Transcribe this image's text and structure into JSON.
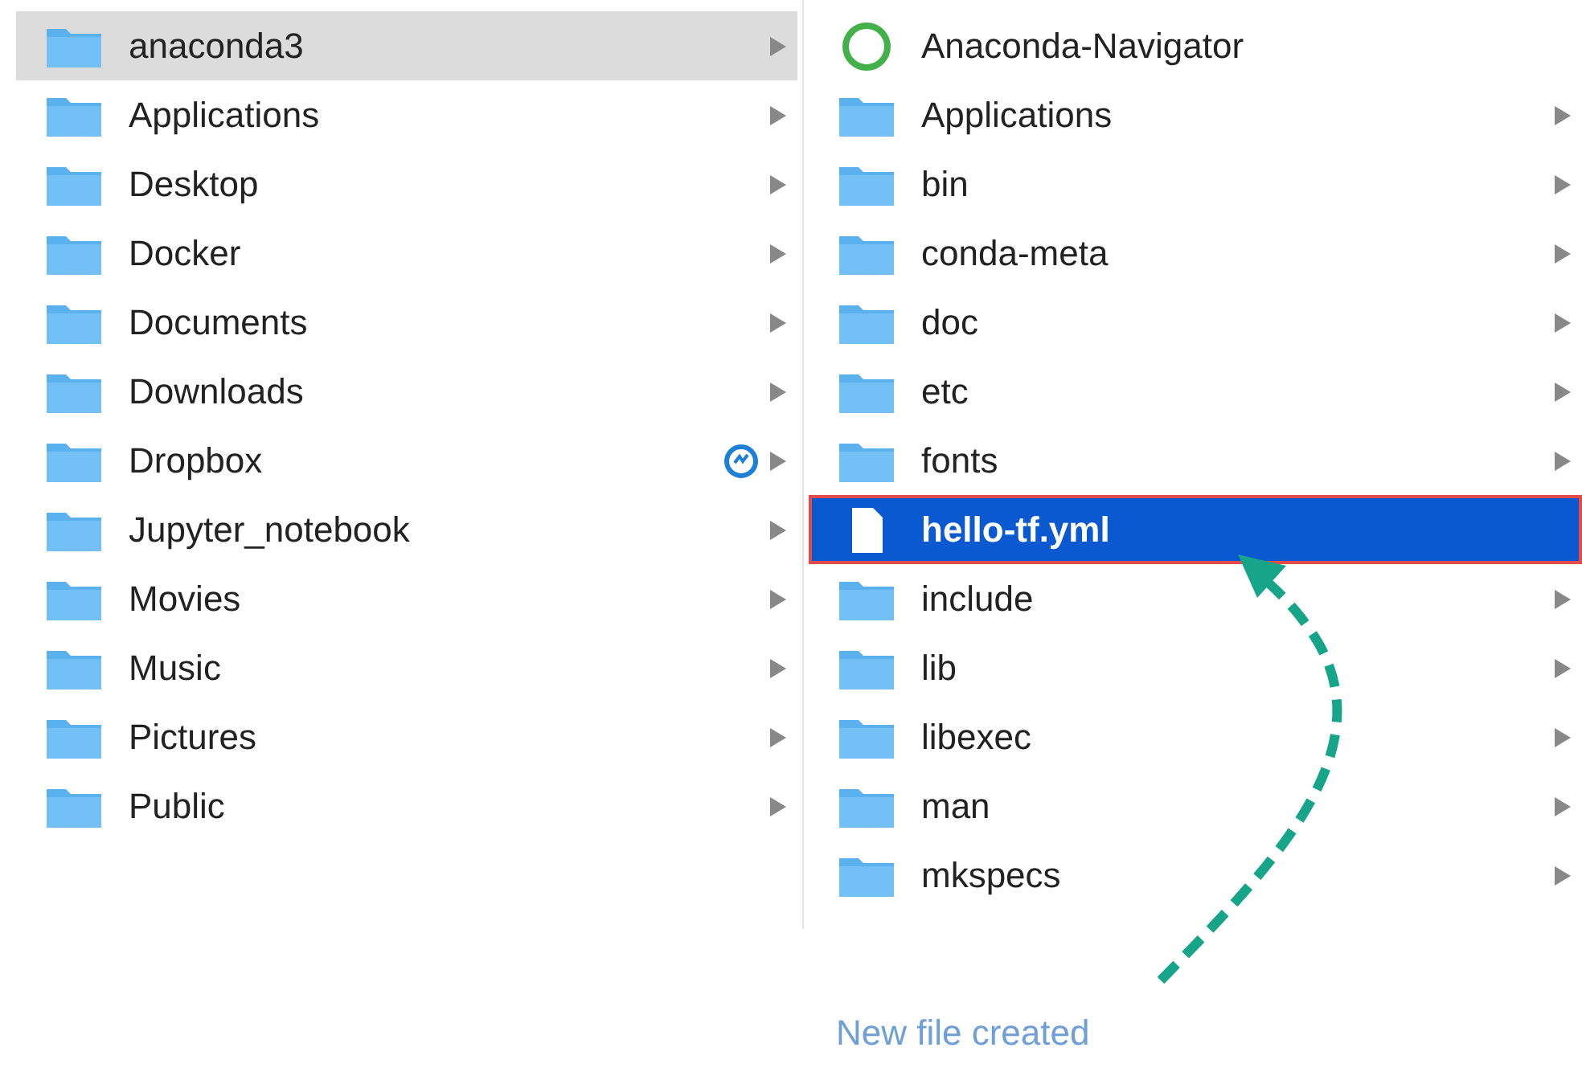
{
  "columns": [
    {
      "items": [
        {
          "name": "anaconda3",
          "kind": "folder",
          "selected": true,
          "has_children": true
        },
        {
          "name": "Applications",
          "kind": "folder",
          "selected": false,
          "has_children": true
        },
        {
          "name": "Desktop",
          "kind": "folder",
          "selected": false,
          "has_children": true
        },
        {
          "name": "Docker",
          "kind": "folder",
          "selected": false,
          "has_children": true
        },
        {
          "name": "Documents",
          "kind": "folder",
          "selected": false,
          "has_children": true
        },
        {
          "name": "Downloads",
          "kind": "folder",
          "selected": false,
          "has_children": true
        },
        {
          "name": "Dropbox",
          "kind": "folder",
          "selected": false,
          "has_children": true,
          "synced": true
        },
        {
          "name": "Jupyter_notebook",
          "kind": "folder",
          "selected": false,
          "has_children": true
        },
        {
          "name": "Movies",
          "kind": "folder",
          "selected": false,
          "has_children": true
        },
        {
          "name": "Music",
          "kind": "folder",
          "selected": false,
          "has_children": true
        },
        {
          "name": "Pictures",
          "kind": "folder",
          "selected": false,
          "has_children": true
        },
        {
          "name": "Public",
          "kind": "folder",
          "selected": false,
          "has_children": true
        }
      ]
    },
    {
      "items": [
        {
          "name": "Anaconda-Navigator",
          "kind": "app",
          "selected": false,
          "has_children": false
        },
        {
          "name": "Applications",
          "kind": "folder",
          "selected": false,
          "has_children": true
        },
        {
          "name": "bin",
          "kind": "folder",
          "selected": false,
          "has_children": true
        },
        {
          "name": "conda-meta",
          "kind": "folder",
          "selected": false,
          "has_children": true
        },
        {
          "name": "doc",
          "kind": "folder",
          "selected": false,
          "has_children": true
        },
        {
          "name": "etc",
          "kind": "folder",
          "selected": false,
          "has_children": true
        },
        {
          "name": "fonts",
          "kind": "folder",
          "selected": false,
          "has_children": true
        },
        {
          "name": "hello-tf.yml",
          "kind": "file",
          "selected": true,
          "has_children": false,
          "outlined": true
        },
        {
          "name": "include",
          "kind": "folder",
          "selected": false,
          "has_children": true
        },
        {
          "name": "lib",
          "kind": "folder",
          "selected": false,
          "has_children": true
        },
        {
          "name": "libexec",
          "kind": "folder",
          "selected": false,
          "has_children": true
        },
        {
          "name": "man",
          "kind": "folder",
          "selected": false,
          "has_children": true
        },
        {
          "name": "mkspecs",
          "kind": "folder",
          "selected": false,
          "has_children": true
        }
      ]
    }
  ],
  "annotation": {
    "caption": "New file created"
  }
}
